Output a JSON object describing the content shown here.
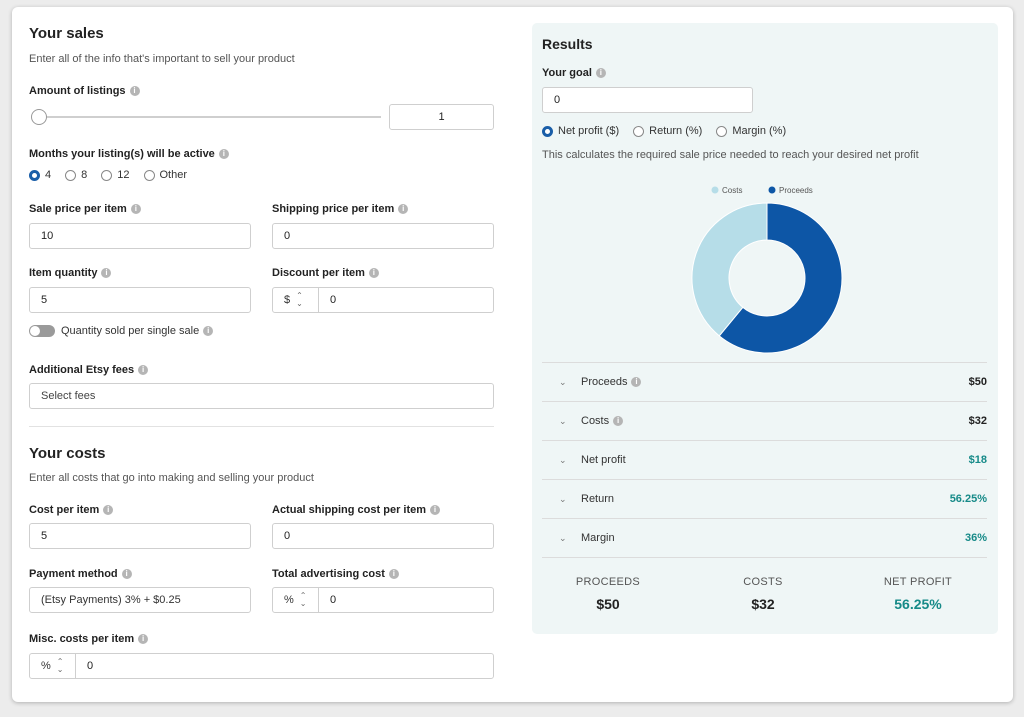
{
  "sales": {
    "title": "Your sales",
    "subtitle": "Enter all of the info that's important to sell your product",
    "listings_label": "Amount of listings",
    "listings_value": "1",
    "months_label": "Months your listing(s) will be active",
    "months_options": [
      "4",
      "8",
      "12",
      "Other"
    ],
    "months_selected": "4",
    "sale_price_label": "Sale price per item",
    "sale_price_value": "10",
    "shipping_price_label": "Shipping price per item",
    "shipping_price_value": "0",
    "item_quantity_label": "Item quantity",
    "item_quantity_value": "5",
    "discount_label": "Discount per item",
    "discount_unit": "$",
    "discount_value": "0",
    "qty_toggle_label": "Quantity sold per single sale",
    "etsy_fees_label": "Additional Etsy fees",
    "etsy_fees_placeholder": "Select fees"
  },
  "costs": {
    "title": "Your costs",
    "subtitle": "Enter all costs that go into making and selling your product",
    "cost_per_item_label": "Cost per item",
    "cost_per_item_value": "5",
    "actual_shipping_label": "Actual shipping cost per item",
    "actual_shipping_value": "0",
    "payment_method_label": "Payment method",
    "payment_method_value": "(Etsy Payments) 3% + $0.25",
    "advertising_label": "Total advertising cost",
    "advertising_unit": "%",
    "advertising_value": "0",
    "misc_label": "Misc. costs per item",
    "misc_unit": "%",
    "misc_value": "0"
  },
  "results": {
    "title": "Results",
    "goal_label": "Your goal",
    "goal_value": "0",
    "goal_options": [
      "Net profit ($)",
      "Return (%)",
      "Margin (%)"
    ],
    "goal_selected": "Net profit ($)",
    "description": "This calculates the required sale price needed to reach your desired net profit",
    "rows": [
      {
        "label": "Proceeds",
        "value": "$50",
        "info": true,
        "teal": false
      },
      {
        "label": "Costs",
        "value": "$32",
        "info": true,
        "teal": false
      },
      {
        "label": "Net profit",
        "value": "$18",
        "info": false,
        "teal": true
      },
      {
        "label": "Return",
        "value": "56.25%",
        "info": false,
        "teal": true
      },
      {
        "label": "Margin",
        "value": "36%",
        "info": false,
        "teal": true
      }
    ],
    "summary": {
      "proceeds_label": "PROCEEDS",
      "proceeds_value": "$50",
      "costs_label": "COSTS",
      "costs_value": "$32",
      "net_label": "NET PROFIT",
      "net_value": "56.25%"
    }
  },
  "chart_data": {
    "type": "pie",
    "categories": [
      "Costs",
      "Proceeds"
    ],
    "values": [
      32,
      50
    ],
    "colors": [
      "#b6dde8",
      "#0d56a6"
    ],
    "legend_position": "top"
  },
  "icons": {
    "info": "info-icon",
    "chevron": "chevron-down-icon",
    "stepper": "stepper-arrows-icon"
  }
}
